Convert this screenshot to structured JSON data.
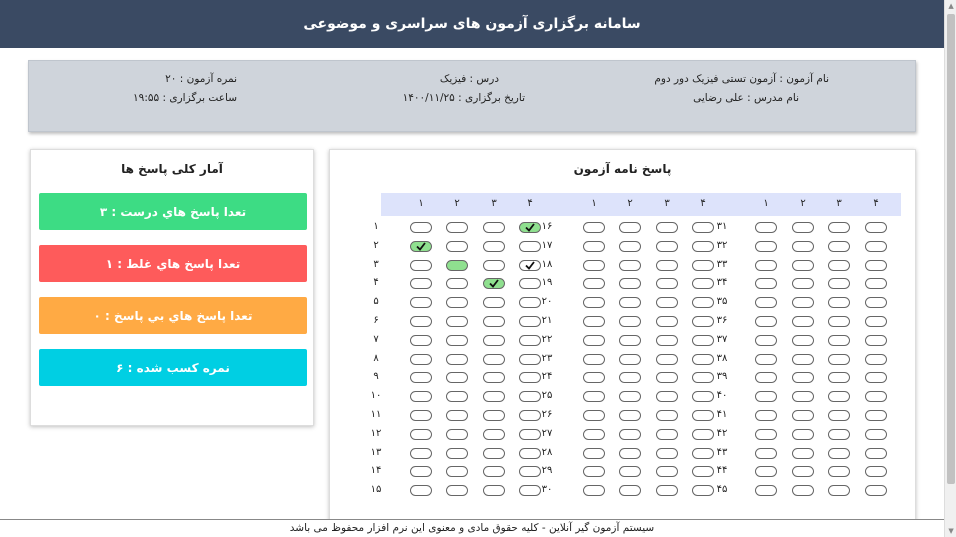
{
  "header": {
    "title": "سامانه برگزاری آزمون های سراسری و موضوعی"
  },
  "exam": {
    "name": "نام آزمون : آزمون تستی فیزیک دور دوم",
    "teacher": "نام مدرس : علی رضایی",
    "course": "درس : فیزیک",
    "date": "تاریخ برگزاری : ۱۴۰۰/۱۱/۲۵",
    "score": "نمره آزمون : ۲۰",
    "time": "ساعت برگزاری : ۱۹:۵۵"
  },
  "stats": {
    "title": "آمار کلی پاسخ ها",
    "correct": "تعدا پاسخ هاي درست : ۳",
    "wrong": "تعدا پاسخ هاي غلط : ۱",
    "blank": "تعدا پاسخ هاي بي پاسخ : ۰",
    "earned": "نمره کسب شده : ۶"
  },
  "answer_sheet": {
    "title": "پاسخ نامه آزمون",
    "option_labels": [
      "۱",
      "۲",
      "۳",
      "۴"
    ],
    "question_labels": [
      "۱",
      "۲",
      "۳",
      "۴",
      "۵",
      "۶",
      "۷",
      "۸",
      "۹",
      "۱۰",
      "۱۱",
      "۱۲",
      "۱۳",
      "۱۴",
      "۱۵",
      "۱۶",
      "۱۷",
      "۱۸",
      "۱۹",
      "۲۰",
      "۲۱",
      "۲۲",
      "۲۳",
      "۲۴",
      "۲۵",
      "۲۶",
      "۲۷",
      "۲۸",
      "۲۹",
      "۳۰",
      "۳۱",
      "۳۲",
      "۳۳",
      "۳۴",
      "۳۵",
      "۳۶",
      "۳۷",
      "۳۸",
      "۳۹",
      "۴۰",
      "۴۱",
      "۴۲",
      "۴۳",
      "۴۴",
      "۴۵"
    ],
    "marks": [
      {
        "question": 1,
        "option": 4,
        "state": "checked-correct"
      },
      {
        "question": 2,
        "option": 1,
        "state": "checked-correct"
      },
      {
        "question": 3,
        "option": 2,
        "state": "correct-key"
      },
      {
        "question": 3,
        "option": 4,
        "state": "checked"
      },
      {
        "question": 4,
        "option": 3,
        "state": "checked-correct"
      }
    ]
  },
  "colors": {
    "header": "#3a4a63",
    "correct": "#3ddc84",
    "wrong": "#fe5b5b",
    "blank": "#ffaa44",
    "earned": "#00cfe3"
  },
  "footer": {
    "text": "سیستم آزمون گیر آنلاین - کلیه حقوق مادی و معنوی این نرم افزار محفوظ می باشد"
  }
}
